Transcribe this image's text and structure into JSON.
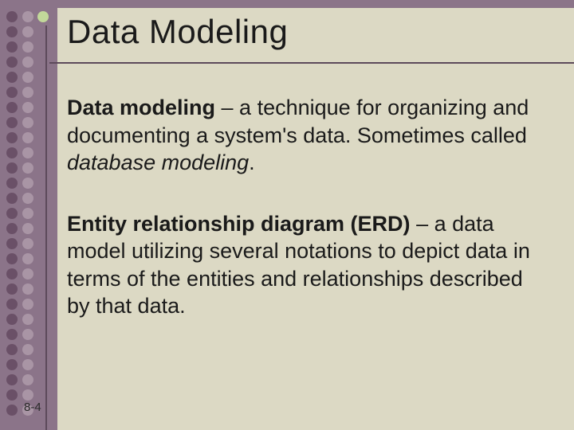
{
  "slide": {
    "title": "Data Modeling",
    "para1_term": "Data modeling",
    "para1_rest1": " – a technique for organizing and documenting a system's data. Sometimes called ",
    "para1_italic": "database modeling",
    "para1_rest2": ".",
    "para2_term": "Entity relationship diagram (ERD)",
    "para2_rest": " – a data model utilizing several notations to depict data in terms of the entities and relationships described by that data.",
    "page_number": "8-4"
  },
  "colors": {
    "stripe": "#8b7489",
    "background": "#dcd9c4",
    "dot_dark": "#6a5067",
    "dot_light": "#a995a5",
    "accent": "#c2d89a"
  }
}
